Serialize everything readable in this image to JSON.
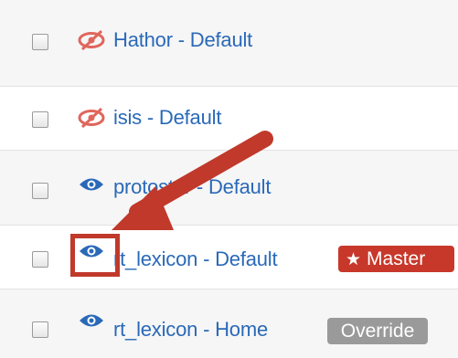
{
  "templates": [
    {
      "name": "Hathor - Default",
      "status_icon": "eye-slash-icon",
      "badge": null
    },
    {
      "name": "isis - Default",
      "status_icon": "eye-slash-icon",
      "badge": null
    },
    {
      "name": "protostar - Default",
      "status_icon": "eye-icon",
      "badge": null
    },
    {
      "name": "rt_lexicon - Default",
      "status_icon": "eye-icon",
      "badge": "Master"
    },
    {
      "name": "rt_lexicon - Home",
      "status_icon": "eye-icon",
      "badge": "Override"
    }
  ],
  "colors": {
    "link": "#2a69b8",
    "hidden_icon": "#e0665c",
    "visible_icon": "#2a69b8",
    "master_badge": "#c7382b",
    "override_badge": "#9a9a9a",
    "annotation": "#c0392b"
  },
  "annotations": [
    "arrow-pointing-to-eye-icon",
    "highlight-box-around-eye-icon"
  ]
}
